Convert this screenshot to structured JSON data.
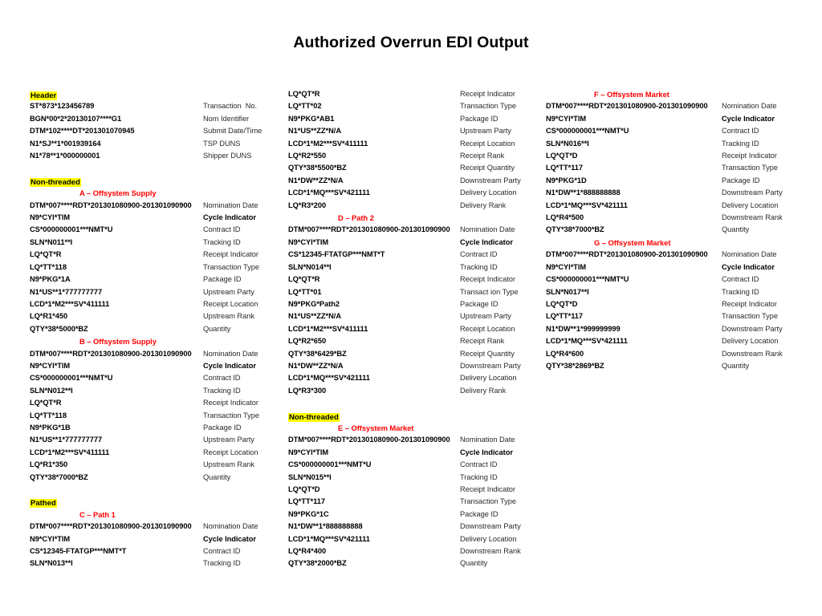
{
  "page": {
    "title": "Authorized Overrun EDI Output"
  },
  "colors": {
    "highlight": "#FFFF00",
    "subheading": "#FF0000",
    "text": "#000000",
    "label": "#2B2B2B",
    "background": "#FFFFFF"
  },
  "columns": [
    {
      "id": "column-1",
      "blocks": [
        {
          "type": "highlight",
          "name": "group-header-header",
          "text": "Header",
          "rows": [
            {
              "segment": "ST*873*123456789",
              "label": "Transaction  No.",
              "bold_label": false
            },
            {
              "segment": "BGN*00*2*20130107****G1",
              "label": "Nom Identifier",
              "bold_label": false
            },
            {
              "segment": "DTM*102****DT*201301070945",
              "label": "Submit Date/Time",
              "bold_label": false
            },
            {
              "segment": "N1*SJ**1*001939164",
              "label": "TSP DUNS",
              "bold_label": false
            },
            {
              "segment": "N1*78**1*000000001",
              "label": "Shipper DUNS",
              "bold_label": false
            }
          ]
        },
        {
          "type": "highlight",
          "name": "group-header-non-threaded",
          "text": "Non-threaded",
          "rows": []
        },
        {
          "type": "subheading",
          "name": "subheading-a-offsystem-supply",
          "text": "A – Offsystem Supply",
          "rows": [
            {
              "segment": "DTM*007****RDT*201301080900-201301090900",
              "label": "Nomination Date",
              "bold_label": false
            },
            {
              "segment": "N9*CYI*TIM",
              "label": "Cycle Indicator",
              "bold_label": true
            },
            {
              "segment": "CS*000000001***NMT*U",
              "label": "Contract ID",
              "bold_label": false
            },
            {
              "segment": "SLN*N011**I",
              "label": "Tracking ID",
              "bold_label": false
            },
            {
              "segment": "LQ*QT*R",
              "label": "Receipt Indicator",
              "bold_label": false
            },
            {
              "segment": "LQ*TT*118",
              "label": "Transaction Type",
              "bold_label": false
            },
            {
              "segment": "N9*PKG*1A",
              "label": "Package ID",
              "bold_label": false
            },
            {
              "segment": "N1*US**1*777777777",
              "label": "Upstream Party",
              "bold_label": false
            },
            {
              "segment": "LCD*1*M2***SV*411111",
              "label": "Receipt Location",
              "bold_label": false
            },
            {
              "segment": "LQ*R1*450",
              "label": "Upstream Rank",
              "bold_label": false
            },
            {
              "segment": "QTY*38*5000*BZ",
              "label": "Quantity",
              "bold_label": false
            }
          ]
        },
        {
          "type": "subheading",
          "name": "subheading-b-offsystem-supply",
          "text": "B – Offsystem Supply",
          "rows": [
            {
              "segment": "DTM*007****RDT*201301080900-201301090900",
              "label": "Nomination Date",
              "bold_label": false
            },
            {
              "segment": "N9*CYI*TIM",
              "label": "Cycle Indicator",
              "bold_label": true
            },
            {
              "segment": "CS*000000001***NMT*U",
              "label": "Contract ID",
              "bold_label": false
            },
            {
              "segment": "SLN*N012**I",
              "label": "Tracking ID",
              "bold_label": false
            },
            {
              "segment": "LQ*QT*R",
              "label": "Receipt Indicator",
              "bold_label": false
            },
            {
              "segment": "LQ*TT*118",
              "label": "Transaction Type",
              "bold_label": false
            },
            {
              "segment": "N9*PKG*1B",
              "label": "Package ID",
              "bold_label": false
            },
            {
              "segment": "N1*US**1*777777777",
              "label": "Upstream Party",
              "bold_label": false
            },
            {
              "segment": "LCD*1*M2***SV*411111",
              "label": "Receipt Location",
              "bold_label": false
            },
            {
              "segment": "LQ*R1*350",
              "label": "Upstream Rank",
              "bold_label": false
            },
            {
              "segment": "QTY*38*7000*BZ",
              "label": "Quantity",
              "bold_label": false
            }
          ]
        },
        {
          "type": "highlight",
          "name": "group-header-pathed",
          "text": "Pathed",
          "rows": []
        },
        {
          "type": "subheading",
          "name": "subheading-c-path-1",
          "text": "C – Path 1",
          "rows": [
            {
              "segment": "DTM*007****RDT*201301080900-201301090900",
              "label": "Nomination Date",
              "bold_label": false
            },
            {
              "segment": "N9*CYI*TIM",
              "label": "Cycle Indicator",
              "bold_label": true
            },
            {
              "segment": "CS*12345-FTATGP***NMT*T",
              "label": "Contract ID",
              "bold_label": false
            },
            {
              "segment": "SLN*N013**I",
              "label": "Tracking ID",
              "bold_label": false
            }
          ]
        }
      ]
    },
    {
      "id": "column-2",
      "blocks": [
        {
          "type": "plain",
          "name": "continuation-path-1",
          "text": "",
          "rows": [
            {
              "segment": "LQ*QT*R",
              "label": "Receipt Indicator",
              "bold_label": false
            },
            {
              "segment": "LQ*TT*02",
              "label": "Transaction Type",
              "bold_label": false
            },
            {
              "segment": "N9*PKG*AB1",
              "label": "Package ID",
              "bold_label": false
            },
            {
              "segment": "N1*US**ZZ*N/A",
              "label": "Upstream Party",
              "bold_label": false
            },
            {
              "segment": "LCD*1*M2***SV*411111",
              "label": "Receipt Location",
              "bold_label": false
            },
            {
              "segment": "LQ*R2*550",
              "label": "Receipt Rank",
              "bold_label": false
            },
            {
              "segment": "QTY*38*5500*BZ",
              "label": "Receipt Quantity",
              "bold_label": false
            },
            {
              "segment": "N1*DW**ZZ*N/A",
              "label": "Downstream Party",
              "bold_label": false
            },
            {
              "segment": "LCD*1*MQ***SV*421111",
              "label": "Delivery Location",
              "bold_label": false
            },
            {
              "segment": "LQ*R3*200",
              "label": "Delivery Rank",
              "bold_label": false
            }
          ]
        },
        {
          "type": "subheading",
          "name": "subheading-d-path-2",
          "text": "D – Path 2",
          "rows": [
            {
              "segment": "DTM*007****RDT*201301080900-201301090900",
              "label": "Nomination Date",
              "bold_label": false
            },
            {
              "segment": "N9*CYI*TIM",
              "label": "Cycle Indicator",
              "bold_label": true
            },
            {
              "segment": "CS*12345-FTATGP***NMT*T",
              "label": "Contract ID",
              "bold_label": false
            },
            {
              "segment": "SLN*N014**I",
              "label": "Tracking ID",
              "bold_label": false
            },
            {
              "segment": "LQ*QT*R",
              "label": "Receipt Indicator",
              "bold_label": false
            },
            {
              "segment": "LQ*TT*01",
              "label": "Transact ion Type",
              "bold_label": false
            },
            {
              "segment": "N9*PKG*Path2",
              "label": "Package ID",
              "bold_label": false
            },
            {
              "segment": "N1*US**ZZ*N/A",
              "label": "Upstream Party",
              "bold_label": false
            },
            {
              "segment": "LCD*1*M2***SV*411111",
              "label": "Receipt Location",
              "bold_label": false
            },
            {
              "segment": "LQ*R2*650",
              "label": "Receipt Rank",
              "bold_label": false
            },
            {
              "segment": "QTY*38*6429*BZ",
              "label": "Receipt Quantity",
              "bold_label": false
            },
            {
              "segment": "N1*DW**ZZ*N/A",
              "label": "Downstream Party",
              "bold_label": false
            },
            {
              "segment": "LCD*1*MQ***SV*421111",
              "label": "Delivery Location",
              "bold_label": false
            },
            {
              "segment": "LQ*R3*300",
              "label": "Delivery Rank",
              "bold_label": false
            }
          ]
        },
        {
          "type": "highlight",
          "name": "group-header-non-threaded-2",
          "text": "Non-threaded",
          "rows": []
        },
        {
          "type": "subheading",
          "name": "subheading-e-offsystem-market",
          "text": "E – Offsystem Market",
          "rows": [
            {
              "segment": "DTM*007****RDT*201301080900-201301090900",
              "label": "Nomination Date",
              "bold_label": false
            },
            {
              "segment": "N9*CYI*TIM",
              "label": "Cycle Indicator",
              "bold_label": true
            },
            {
              "segment": "CS*000000001***NMT*U",
              "label": "Contract ID",
              "bold_label": false
            },
            {
              "segment": "SLN*N015**I",
              "label": "Tracking ID",
              "bold_label": false
            },
            {
              "segment": "LQ*QT*D",
              "label": "Receipt Indicator",
              "bold_label": false
            },
            {
              "segment": "LQ*TT*117",
              "label": "Transaction Type",
              "bold_label": false
            },
            {
              "segment": "N9*PKG*1C",
              "label": "Package ID",
              "bold_label": false
            },
            {
              "segment": "N1*DW**1*888888888",
              "label": "Downstream Party",
              "bold_label": false
            },
            {
              "segment": "LCD*1*MQ***SV*421111",
              "label": "Delivery Location",
              "bold_label": false
            },
            {
              "segment": "LQ*R4*400",
              "label": "Downstream Rank",
              "bold_label": false
            },
            {
              "segment": "QTY*38*2000*BZ",
              "label": "Quantity",
              "bold_label": false
            }
          ]
        }
      ]
    },
    {
      "id": "column-3",
      "blocks": [
        {
          "type": "subheading",
          "name": "subheading-f-offsystem-market",
          "text": "F – Offsystem Market",
          "rows": [
            {
              "segment": "DTM*007****RDT*201301080900-201301090900",
              "label": "Nomination Date",
              "bold_label": false
            },
            {
              "segment": "N9*CYI*TIM",
              "label": "Cycle Indicator",
              "bold_label": true
            },
            {
              "segment": "CS*000000001***NMT*U",
              "label": "Contract ID",
              "bold_label": false
            },
            {
              "segment": "SLN*N016**I",
              "label": "Tracking ID",
              "bold_label": false
            },
            {
              "segment": "LQ*QT*D",
              "label": "Receipt Indicator",
              "bold_label": false
            },
            {
              "segment": "LQ*TT*117",
              "label": "Transaction Type",
              "bold_label": false
            },
            {
              "segment": "N9*PKG*1D",
              "label": "Package ID",
              "bold_label": false
            },
            {
              "segment": "N1*DW**1*888888888",
              "label": "Downstream Party",
              "bold_label": false
            },
            {
              "segment": "LCD*1*MQ***SV*421111",
              "label": "Delivery Location",
              "bold_label": false
            },
            {
              "segment": "LQ*R4*500",
              "label": "Downstream Rank",
              "bold_label": false
            },
            {
              "segment": "QTY*38*7000*BZ",
              "label": "Quantity",
              "bold_label": false
            }
          ]
        },
        {
          "type": "subheading",
          "name": "subheading-g-offsystem-market",
          "text": "G – Offsystem Market",
          "rows": [
            {
              "segment": "DTM*007****RDT*201301080900-201301090900",
              "label": "Nomination Date",
              "bold_label": false
            },
            {
              "segment": "N9*CYI*TIM",
              "label": "Cycle Indicator",
              "bold_label": true
            },
            {
              "segment": "CS*000000001***NMT*U",
              "label": "Contract ID",
              "bold_label": false
            },
            {
              "segment": "SLN*N017**I",
              "label": "Tracking ID",
              "bold_label": false
            },
            {
              "segment": "LQ*QT*D",
              "label": "Receipt Indicator",
              "bold_label": false
            },
            {
              "segment": "LQ*TT*117",
              "label": "Transaction Type",
              "bold_label": false
            },
            {
              "segment": "N1*DW**1*999999999",
              "label": "Downstream Party",
              "bold_label": false
            },
            {
              "segment": "LCD*1*MQ***SV*421111",
              "label": "Delivery Location",
              "bold_label": false
            },
            {
              "segment": "LQ*R4*600",
              "label": "Downstream Rank",
              "bold_label": false
            },
            {
              "segment": "QTY*38*2869*BZ",
              "label": "Quantity",
              "bold_label": false
            }
          ]
        }
      ]
    }
  ]
}
